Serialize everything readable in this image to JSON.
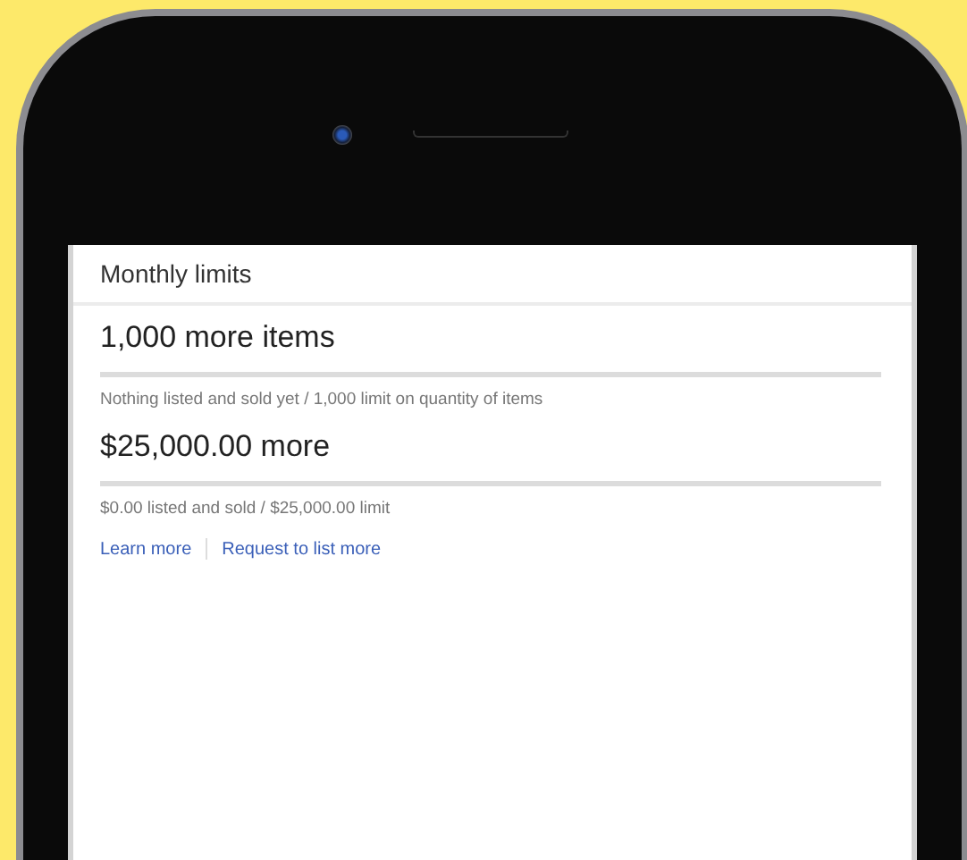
{
  "header": {
    "title": "Monthly limits"
  },
  "limits": [
    {
      "amount": "1,000 more items",
      "level": 0,
      "detail": "Nothing listed and sold yet / 1,000 limit on quantity of items"
    },
    {
      "amount": "$25,000.00 more",
      "level": 0,
      "detail": "$0.00 listed and sold / $25,000.00 limit"
    }
  ],
  "links": [
    "Learn more",
    "Request to list more"
  ]
}
